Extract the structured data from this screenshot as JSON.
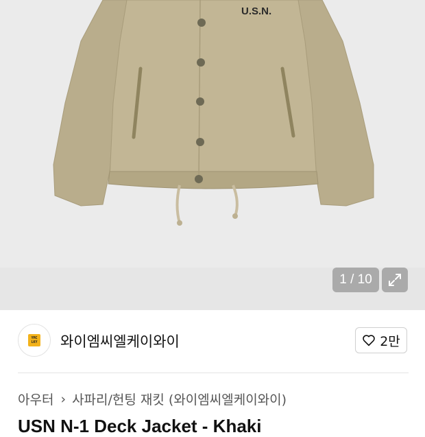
{
  "gallery": {
    "counter_text": "1 / 10",
    "print_text": "U.S.N."
  },
  "seller": {
    "name": "와이엠씨엘케이와이",
    "logo_text": "YMC LKY",
    "like_count": "2만"
  },
  "breadcrumb": {
    "category": "아우터",
    "subcategory": "사파리/헌팅 재킷 (와이엠씨엘케이와이)"
  },
  "product": {
    "title": "USN N-1 Deck Jacket - Khaki"
  },
  "colors": {
    "khaki": "#bfb291",
    "logo_accent": "#f3b21a"
  }
}
